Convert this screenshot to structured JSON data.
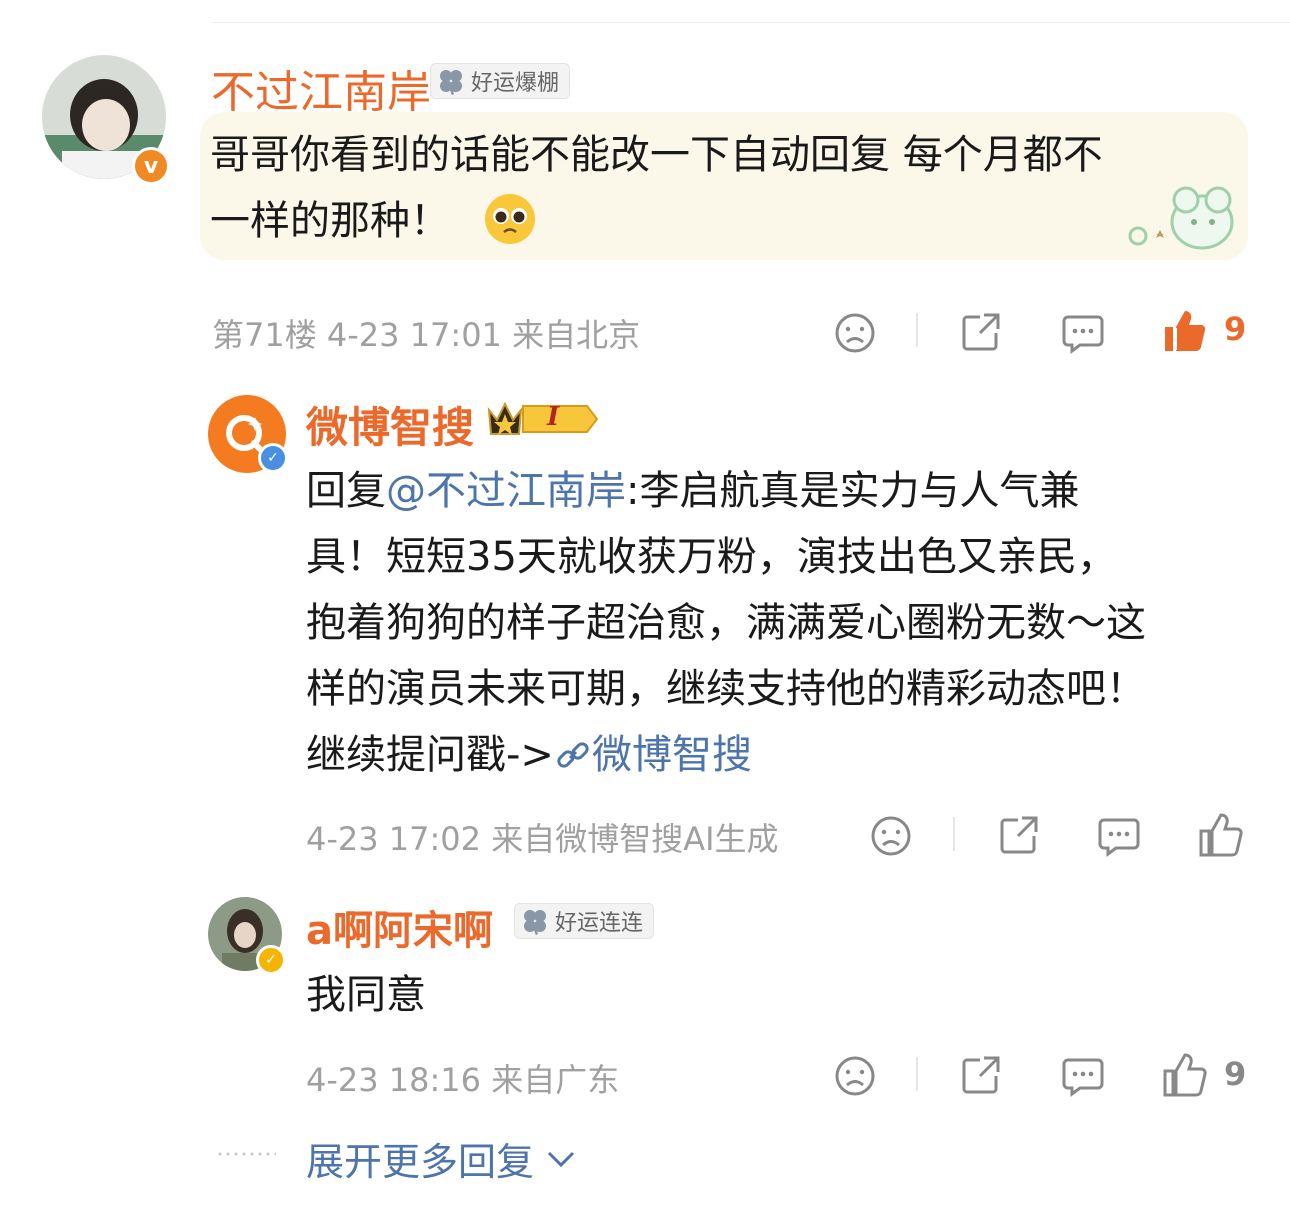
{
  "comment": {
    "author": "不过江南岸",
    "badge": "好运爆棚",
    "verify_mark": "v",
    "text_line1": "哥哥你看到的话能不能改一下自动回复 每个月都不",
    "text_line2": "一样的那种！",
    "emoji": "pleading-face-emoji",
    "meta": "第71楼  4-23 17:01  来自北京",
    "like_count": "9"
  },
  "replies": [
    {
      "author": "微博智搜",
      "level": "I",
      "reply_prefix": "回复",
      "mention": "@不过江南岸",
      "text_l1_rest": ":李启航真是实力与人气兼",
      "text_l2": "具！短短35天就收获万粉，演技出色又亲民，",
      "text_l3": "抱着狗狗的样子超治愈，满满爱心圈粉无数～这",
      "text_l4": "样的演员未来可期，继续支持他的精彩动态吧！",
      "text_l5_prefix": "继续提问戳->",
      "link_text": "微博智搜",
      "meta": "4-23 17:02  来自微博智搜AI生成"
    },
    {
      "author": "a啊阿宋啊",
      "badge": "好运连连",
      "text": "我同意",
      "meta": "4-23 18:16  来自广东",
      "like_count": "9"
    }
  ],
  "expand_label": "展开更多回复",
  "colors": {
    "name": "#eb6a2b",
    "link": "#4d74ab",
    "like_active": "#eb6a2b",
    "meta": "#a0a0a0"
  }
}
